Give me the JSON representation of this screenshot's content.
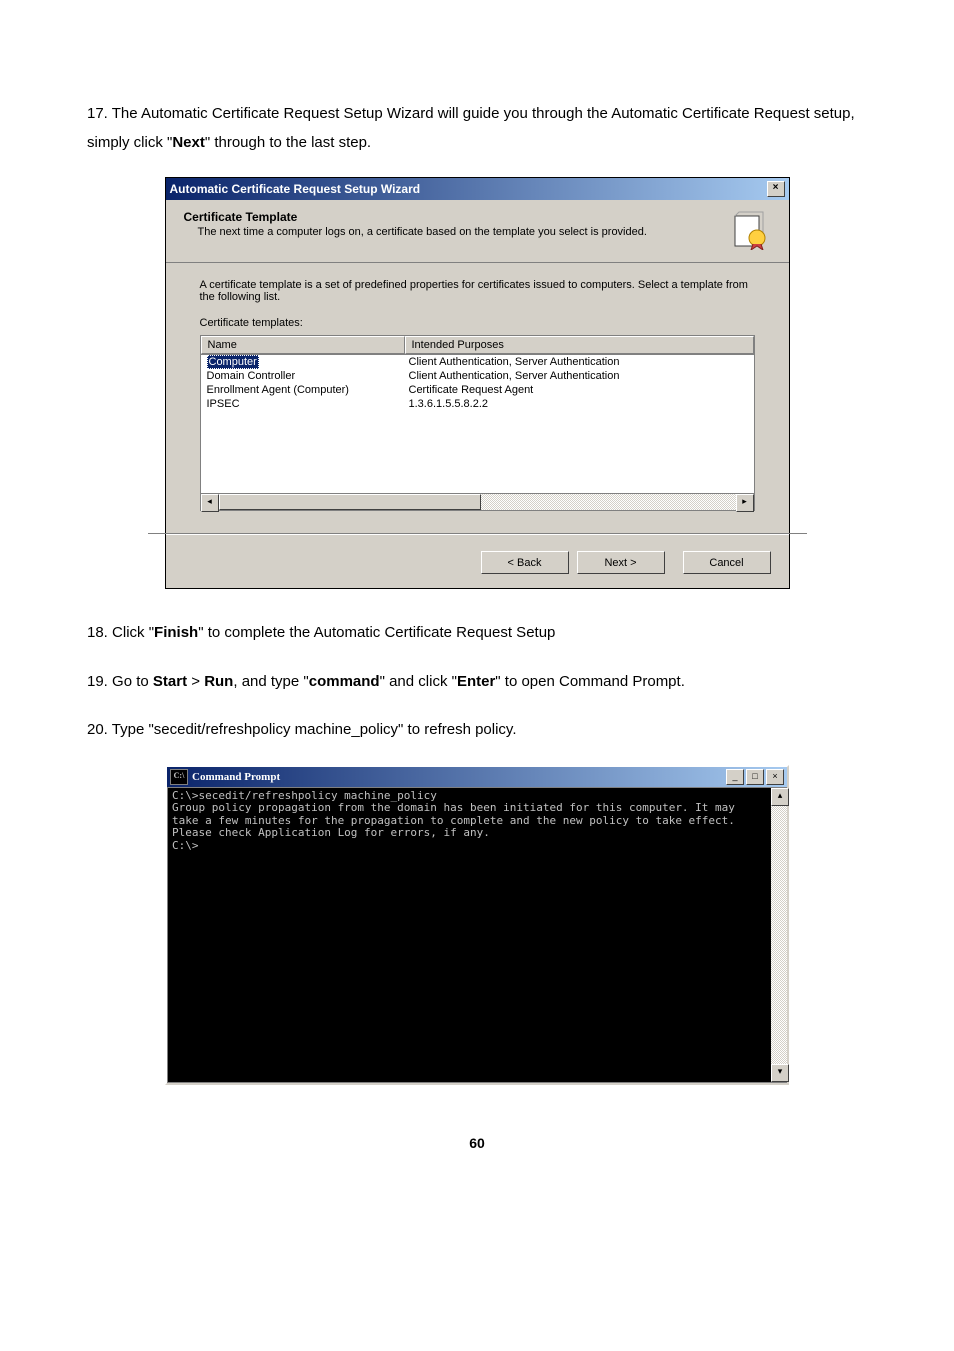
{
  "step17": {
    "num": "17.",
    "text_before_bold": "The Automatic Certificate Request Setup Wizard will guide you through the Automatic Certificate Request setup, simply click \"",
    "bold": "Next",
    "text_after_bold": "\" through to the last step."
  },
  "dialog": {
    "title": "Automatic Certificate Request Setup Wizard",
    "header_title": "Certificate Template",
    "header_desc": "The next time a computer logs on, a certificate based on the template you select is provided.",
    "body_text": "A certificate template is a set of predefined properties for certificates issued to computers. Select a template from the following list.",
    "list_label": "Certificate templates:",
    "columns": {
      "c1": "Name",
      "c2": "Intended Purposes"
    },
    "rows": [
      {
        "name": "Computer",
        "purpose": "Client Authentication, Server Authentication",
        "selected": true
      },
      {
        "name": "Domain Controller",
        "purpose": "Client Authentication, Server Authentication",
        "selected": false
      },
      {
        "name": "Enrollment Agent (Computer)",
        "purpose": "Certificate Request Agent",
        "selected": false
      },
      {
        "name": "IPSEC",
        "purpose": "1.3.6.1.5.5.8.2.2",
        "selected": false
      }
    ],
    "buttons": {
      "back": "< Back",
      "next": "Next >",
      "cancel": "Cancel"
    }
  },
  "step18": {
    "num": "18.",
    "t1": "Click \"",
    "b1": "Finish",
    "t2": "\" to complete the Automatic Certificate Request Setup"
  },
  "step19": {
    "num": "19.",
    "t1": "Go to ",
    "b1": "Start",
    "t2": " > ",
    "b2": "Run",
    "t3": ", and type \"",
    "b3": "command",
    "t4": "\" and click \"",
    "b4": "Enter",
    "t5": "\" to open Command Prompt."
  },
  "step20": {
    "num": "20.",
    "text": "Type \"secedit/refreshpolicy machine_policy\" to refresh policy."
  },
  "cmd": {
    "title": "Command Prompt",
    "icon_text": "C:\\",
    "body": "C:\\>secedit/refreshpolicy machine_policy\nGroup policy propagation from the domain has been initiated for this computer. It may take a few minutes for the propagation to complete and the new policy to take effect.  Please check Application Log for errors, if any.\nC:\\>"
  },
  "page_number": "60"
}
